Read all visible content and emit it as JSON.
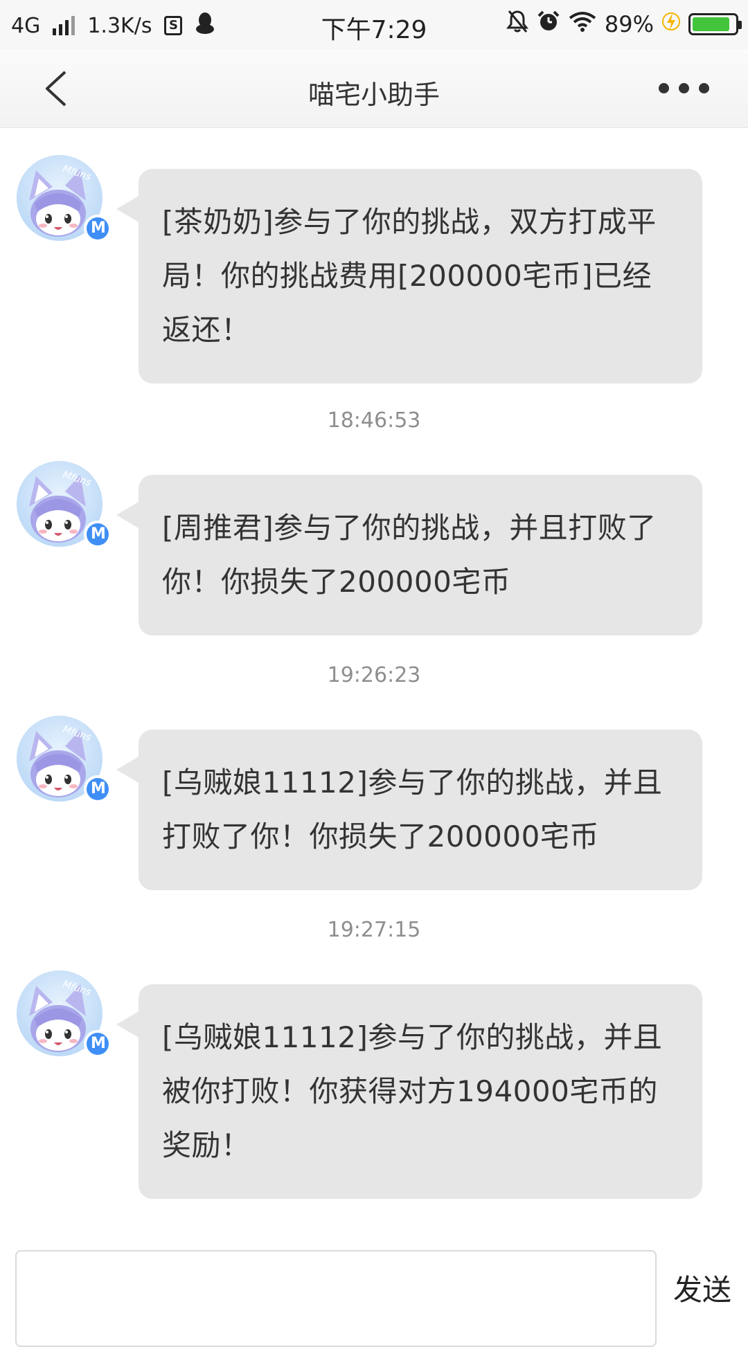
{
  "status_bar": {
    "network": "4G",
    "speed": "1.3K/s",
    "sim_label": "S",
    "time": "下午7:29",
    "battery": "89%",
    "battery_level": 0.89
  },
  "nav": {
    "title": "喵宅小助手"
  },
  "messages": [
    {
      "text": "[茶奶奶]参与了你的挑战，双方打成平局！你的挑战费用[200000宅币]已经返还！",
      "avatar_text": "Mfuns",
      "badge": "M"
    },
    {
      "timestamp": "18:46:53",
      "text": "[周推君]参与了你的挑战，并且打败了你！你损失了200000宅币",
      "avatar_text": "Mfuns",
      "badge": "M"
    },
    {
      "timestamp": "19:26:23",
      "text": "[乌贼娘11112]参与了你的挑战，并且打败了你！你损失了200000宅币",
      "avatar_text": "Mfuns",
      "badge": "M"
    },
    {
      "timestamp": "19:27:15",
      "text": "[乌贼娘11112]参与了你的挑战，并且被你打败！你获得对方194000宅币的奖励！",
      "avatar_text": "Mfuns",
      "badge": "M"
    }
  ],
  "input": {
    "value": "",
    "placeholder": "",
    "send_label": "发送"
  }
}
